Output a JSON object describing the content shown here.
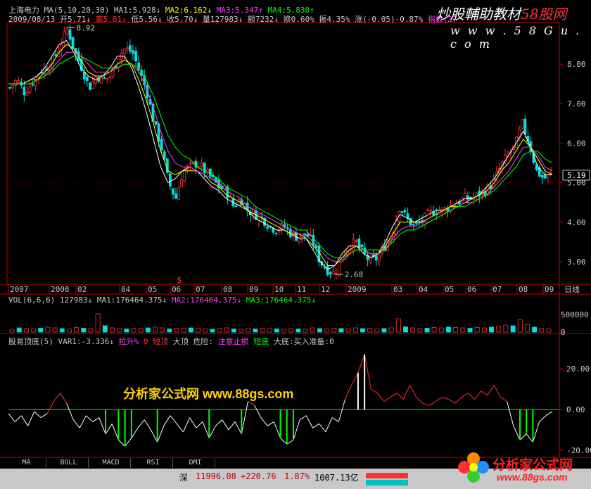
{
  "watermark": {
    "main": "炒股輔助教材",
    "brand": "58股网",
    "url": "w w w . 5 8 G u . c o m",
    "overlay": "分析家公式网 www.88gs.com",
    "logo": "分析家公式网",
    "logo_url": "www.88gs.com"
  },
  "header": {
    "row1": [
      {
        "text": "上海电力",
        "c": "w"
      },
      {
        "text": "MA(5,10,20,30)",
        "c": "w"
      },
      {
        "text": "MA1:5.928↓",
        "c": "w"
      },
      {
        "text": "MA2:6.162↓",
        "c": "y"
      },
      {
        "text": "MA3:5.347↑",
        "c": "m"
      },
      {
        "text": "MA4:5.830↑",
        "c": "g"
      }
    ],
    "row2": [
      {
        "text": "2009/08/13",
        "c": "w"
      },
      {
        "text": "开5.71↓",
        "c": "w"
      },
      {
        "text": "高5.81↓",
        "c": "r"
      },
      {
        "text": "低5.56↓",
        "c": "w"
      },
      {
        "text": "收5.70↓",
        "c": "w"
      },
      {
        "text": "量127983↓",
        "c": "w"
      },
      {
        "text": "额7232↓",
        "c": "w"
      },
      {
        "text": "换0.60%",
        "c": "w"
      },
      {
        "text": "振4.35%",
        "c": "w"
      },
      {
        "text": "涨(-0.05)-0.87%",
        "c": "w"
      },
      {
        "text": "指数(27",
        "c": "m"
      }
    ]
  },
  "vol_header": [
    {
      "text": "VOL(6,6,6)",
      "c": "w"
    },
    {
      "text": "127983↓",
      "c": "w"
    },
    {
      "text": "MA1:176464.375↓",
      "c": "w"
    },
    {
      "text": "MA2:176464.375↓",
      "c": "m"
    },
    {
      "text": "MA3:176464.375↓",
      "c": "g"
    }
  ],
  "ind_header": [
    {
      "text": "股易顶底(5)",
      "c": "w"
    },
    {
      "text": "VAR1:-3.336↓",
      "c": "w"
    },
    {
      "text": "拉升%",
      "c": "m"
    },
    {
      "text": "0",
      "c": "r"
    },
    {
      "text": "短顶",
      "c": "r"
    },
    {
      "text": "大顶",
      "c": "w"
    },
    {
      "text": "危险:",
      "c": "w"
    },
    {
      "text": "注意止损",
      "c": "m"
    },
    {
      "text": "短底",
      "c": "g"
    },
    {
      "text": "大底:买入准备:0",
      "c": "w"
    }
  ],
  "tabs": [
    "MA",
    "BOLL",
    "MACD",
    "RSI",
    "DMI"
  ],
  "status": {
    "market": "深",
    "index": "11996.08",
    "change": "+220.76",
    "pct": "1.87%",
    "amount": "1007.13亿"
  },
  "chart_data": [
    {
      "type": "candlestick",
      "title": "上海电力",
      "ylim": [
        2.5,
        9.0
      ],
      "y_ticks": [
        "8.00",
        "7.00",
        "6.00",
        "5.00",
        "4.00",
        "3.00"
      ],
      "current_price_label": "5.19",
      "x_ticks": [
        "2007",
        "2008",
        "02",
        "04",
        "05",
        "06",
        "07",
        "08",
        "09",
        "10",
        "11",
        "12",
        "2009",
        "03",
        "04",
        "05",
        "06",
        "07",
        "08",
        "09"
      ],
      "x_mark": "$",
      "period_label": "日线",
      "annotations": [
        {
          "text": "8.92",
          "where": "high"
        },
        {
          "text": "2.68",
          "where": "low"
        }
      ],
      "close_path": [
        7.4,
        7.6,
        7.3,
        7.5,
        7.8,
        7.9,
        8.1,
        8.5,
        8.9,
        8.3,
        7.9,
        7.4,
        7.7,
        7.6,
        7.7,
        8.2,
        8.4,
        8.3,
        7.8,
        7.3,
        6.5,
        5.9,
        5.0,
        4.6,
        5.3,
        5.4,
        5.5,
        5.3,
        5.1,
        4.9,
        4.8,
        4.4,
        4.6,
        4.3,
        4.2,
        4.1,
        3.9,
        3.8,
        3.9,
        3.7,
        3.6,
        3.7,
        3.5,
        3.0,
        2.8,
        2.7,
        3.1,
        3.4,
        3.5,
        3.2,
        3.0,
        3.1,
        3.4,
        3.7,
        4.4,
        4.1,
        3.9,
        4.0,
        4.2,
        4.3,
        4.3,
        4.4,
        4.5,
        4.6,
        4.6,
        4.7,
        4.8,
        5.0,
        5.4,
        5.7,
        5.9,
        6.5,
        6.0,
        5.3,
        5.1,
        5.2
      ],
      "ma_series": [
        {
          "name": "MA1",
          "color": "#ffffff",
          "values": [
            7.5,
            7.5,
            7.5,
            7.6,
            7.7,
            7.9,
            8.2,
            8.5,
            8.6,
            8.3,
            7.9,
            7.7,
            7.6,
            7.7,
            7.9,
            8.2,
            8.2,
            7.9,
            7.4,
            6.8,
            6.1,
            5.4,
            5.0,
            5.1,
            5.3,
            5.4,
            5.3,
            5.1,
            4.9,
            4.8,
            4.6,
            4.5,
            4.4,
            4.3,
            4.1,
            4.0,
            3.9,
            3.8,
            3.8,
            3.7,
            3.6,
            3.6,
            3.3,
            3.0,
            2.8,
            2.9,
            3.2,
            3.4,
            3.4,
            3.2,
            3.1,
            3.2,
            3.5,
            3.9,
            4.2,
            4.1,
            4.0,
            4.1,
            4.2,
            4.3,
            4.3,
            4.4,
            4.5,
            4.6,
            4.6,
            4.7,
            4.9,
            5.1,
            5.4,
            5.7,
            6.0,
            6.3,
            5.9,
            5.4,
            5.2,
            5.2
          ]
        },
        {
          "name": "MA2",
          "color": "#ffff00",
          "values": [
            7.5,
            7.5,
            7.5,
            7.6,
            7.6,
            7.8,
            8.0,
            8.3,
            8.5,
            8.4,
            8.1,
            7.8,
            7.7,
            7.7,
            7.8,
            8.0,
            8.1,
            8.0,
            7.6,
            7.1,
            6.5,
            5.8,
            5.3,
            5.2,
            5.3,
            5.3,
            5.3,
            5.2,
            5.0,
            4.9,
            4.7,
            4.6,
            4.5,
            4.3,
            4.2,
            4.1,
            4.0,
            3.9,
            3.8,
            3.7,
            3.7,
            3.6,
            3.4,
            3.2,
            2.9,
            2.9,
            3.1,
            3.3,
            3.4,
            3.3,
            3.2,
            3.2,
            3.4,
            3.7,
            4.0,
            4.0,
            4.0,
            4.0,
            4.1,
            4.2,
            4.3,
            4.4,
            4.4,
            4.5,
            4.6,
            4.7,
            4.8,
            5.0,
            5.3,
            5.5,
            5.8,
            6.1,
            5.9,
            5.6,
            5.3,
            5.2
          ]
        },
        {
          "name": "MA3",
          "color": "#ff40ff",
          "values": [
            7.5,
            7.5,
            7.5,
            7.5,
            7.6,
            7.7,
            7.9,
            8.1,
            8.3,
            8.3,
            8.2,
            8.0,
            7.8,
            7.8,
            7.8,
            7.9,
            8.0,
            8.0,
            7.8,
            7.4,
            6.9,
            6.3,
            5.8,
            5.5,
            5.4,
            5.4,
            5.3,
            5.2,
            5.1,
            5.0,
            4.8,
            4.7,
            4.6,
            4.4,
            4.3,
            4.2,
            4.1,
            4.0,
            3.9,
            3.8,
            3.7,
            3.7,
            3.5,
            3.3,
            3.1,
            3.0,
            3.0,
            3.2,
            3.3,
            3.3,
            3.2,
            3.2,
            3.3,
            3.6,
            3.8,
            3.9,
            3.9,
            4.0,
            4.0,
            4.1,
            4.2,
            4.3,
            4.4,
            4.5,
            4.5,
            4.6,
            4.7,
            4.9,
            5.1,
            5.3,
            5.6,
            5.9,
            5.9,
            5.7,
            5.4,
            5.3
          ]
        },
        {
          "name": "MA4",
          "color": "#00ff00",
          "values": [
            7.5,
            7.5,
            7.5,
            7.5,
            7.6,
            7.7,
            7.8,
            8.0,
            8.1,
            8.2,
            8.2,
            8.1,
            8.0,
            7.9,
            7.9,
            7.9,
            8.0,
            8.0,
            7.9,
            7.6,
            7.2,
            6.7,
            6.2,
            5.9,
            5.7,
            5.6,
            5.4,
            5.3,
            5.2,
            5.1,
            4.9,
            4.8,
            4.7,
            4.6,
            4.4,
            4.3,
            4.2,
            4.1,
            4.0,
            3.9,
            3.8,
            3.8,
            3.6,
            3.4,
            3.2,
            3.1,
            3.1,
            3.2,
            3.3,
            3.3,
            3.3,
            3.3,
            3.3,
            3.5,
            3.7,
            3.8,
            3.8,
            3.9,
            4.0,
            4.1,
            4.2,
            4.3,
            4.4,
            4.4,
            4.5,
            4.6,
            4.7,
            4.8,
            5.0,
            5.2,
            5.4,
            5.7,
            5.8,
            5.8,
            5.6,
            5.5
          ]
        }
      ]
    },
    {
      "type": "bar",
      "title": "VOL(6,6,6)",
      "ylim": [
        0,
        800000
      ],
      "y_ticks": [
        "500000",
        "0"
      ],
      "values": [
        8,
        12,
        10,
        9,
        11,
        14,
        12,
        10,
        9,
        13,
        11,
        10,
        52,
        18,
        12,
        10,
        9,
        11,
        10,
        12,
        14,
        12,
        9,
        11,
        10,
        12,
        10,
        9,
        8,
        10,
        12,
        9,
        8,
        10,
        9,
        11,
        10,
        9,
        8,
        10,
        9,
        8,
        12,
        10,
        9,
        11,
        10,
        9,
        12,
        10,
        11,
        9,
        10,
        12,
        38,
        15,
        12,
        10,
        11,
        13,
        12,
        14,
        13,
        12,
        11,
        13,
        12,
        14,
        16,
        20,
        18,
        35,
        22,
        14,
        10,
        9
      ]
    },
    {
      "type": "line",
      "title": "股易顶底(5)",
      "ylim": [
        -20,
        30
      ],
      "y_ticks": [
        "20.00",
        "0.00",
        "-20.00"
      ],
      "values": [
        -2,
        -6,
        -3,
        -8,
        -1,
        -4,
        -2,
        4,
        8,
        3,
        -5,
        -9,
        -3,
        -6,
        -4,
        -12,
        -7,
        -15,
        -18,
        -14,
        -9,
        -5,
        -10,
        -16,
        -8,
        -3,
        -7,
        -11,
        -4,
        -9,
        -6,
        -14,
        -8,
        -5,
        -10,
        -6,
        -12,
        4,
        2,
        -4,
        -8,
        -6,
        -14,
        -17,
        -15,
        -5,
        -3,
        -9,
        -7,
        -11,
        -4,
        -6,
        5,
        12,
        18,
        27,
        10,
        8,
        4,
        6,
        8,
        5,
        12,
        6,
        3,
        2,
        4,
        6,
        5,
        3,
        6,
        8,
        5,
        9,
        7,
        12,
        6,
        4,
        -8,
        -15,
        -12,
        -16,
        -6,
        -3,
        -1
      ]
    }
  ]
}
